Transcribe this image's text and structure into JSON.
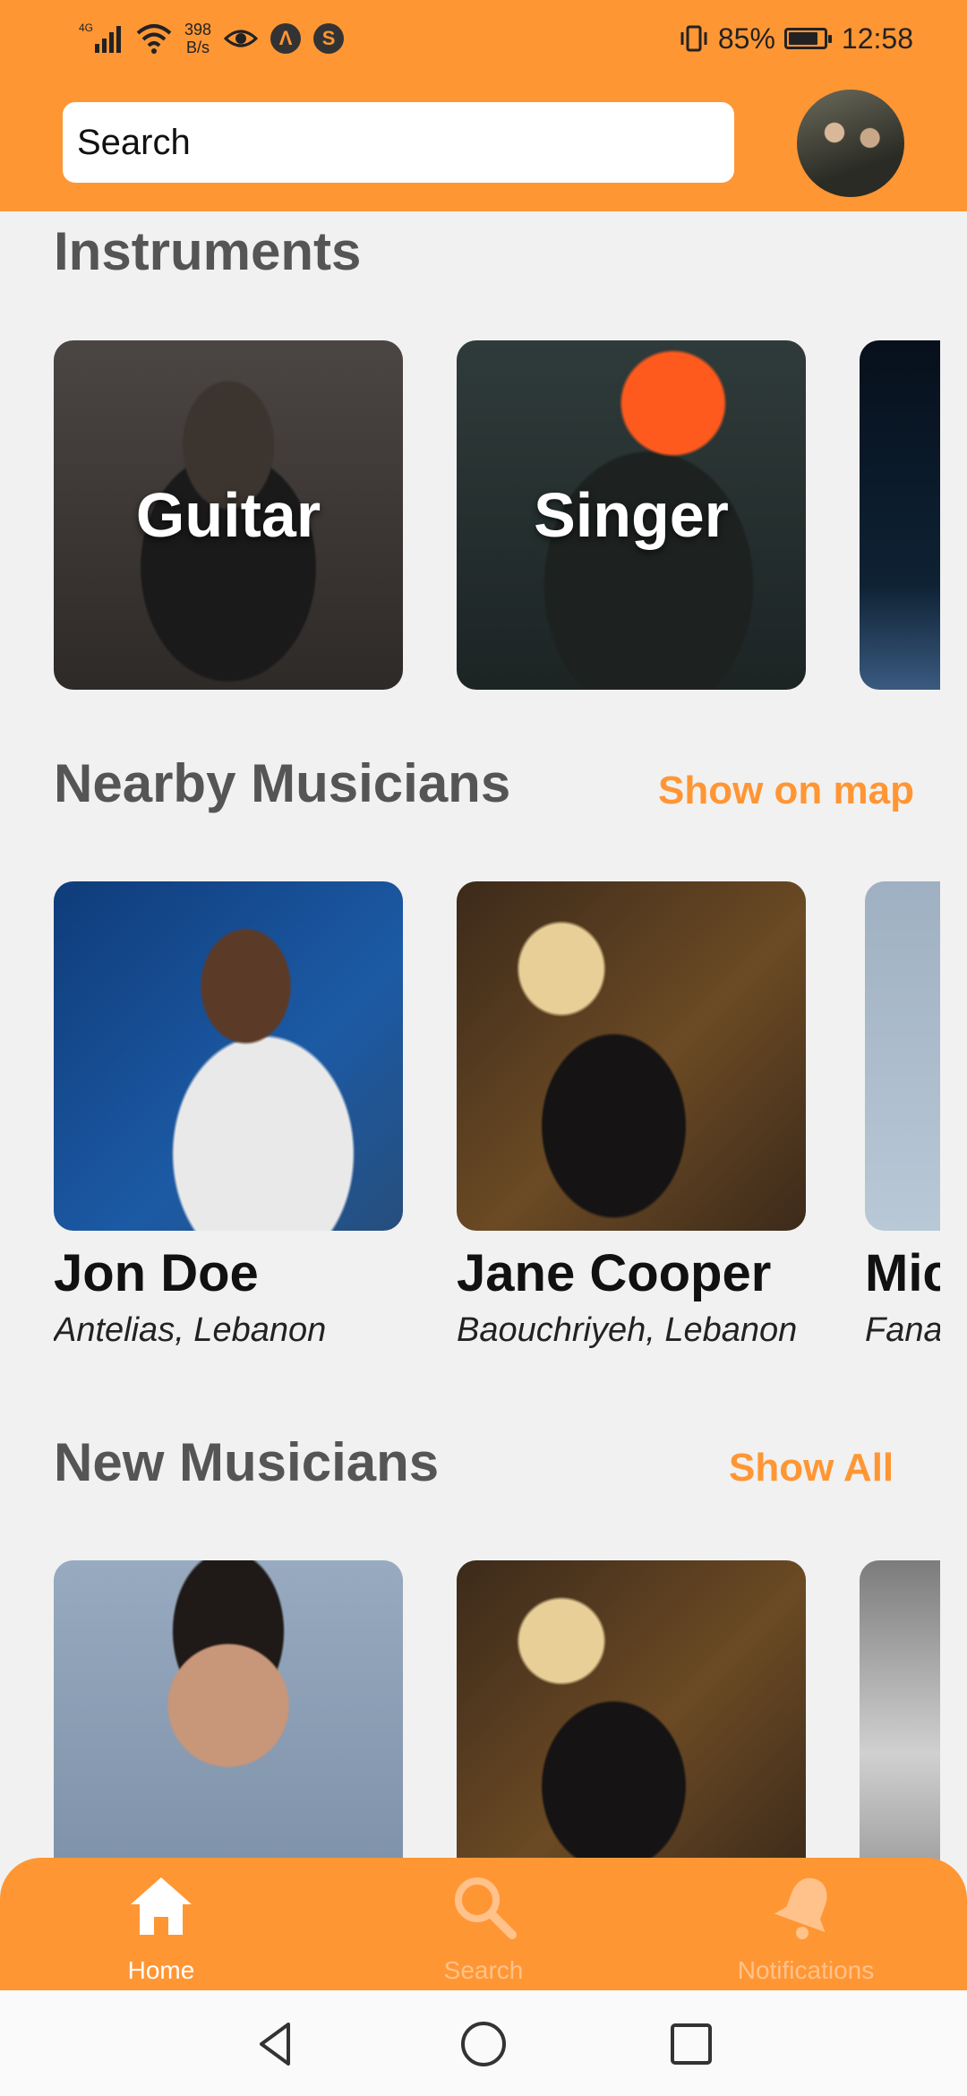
{
  "status_bar": {
    "network": "4G",
    "speed_value": "398",
    "speed_unit": "B/s",
    "battery": "85%",
    "battery_level": 0.85,
    "time": "12:58"
  },
  "header": {
    "search_placeholder": "Search"
  },
  "instruments": {
    "title": "Instruments",
    "items": [
      {
        "label": "Guitar"
      },
      {
        "label": "Singer"
      },
      {
        "label": ""
      }
    ]
  },
  "nearby": {
    "title": "Nearby Musicians",
    "link": "Show on map",
    "items": [
      {
        "name": "Jon Doe",
        "location": "Antelias, Lebanon"
      },
      {
        "name": "Jane Cooper",
        "location": "Baouchriyeh, Lebanon"
      },
      {
        "name": "Mic",
        "location": "Fana"
      }
    ]
  },
  "new_musicians": {
    "title": "New Musicians",
    "link": "Show All"
  },
  "bottom_nav": {
    "home": "Home",
    "search": "Search",
    "notifications": "Notifications"
  },
  "colors": {
    "accent": "#ff9634",
    "background": "#f1f1f1"
  }
}
